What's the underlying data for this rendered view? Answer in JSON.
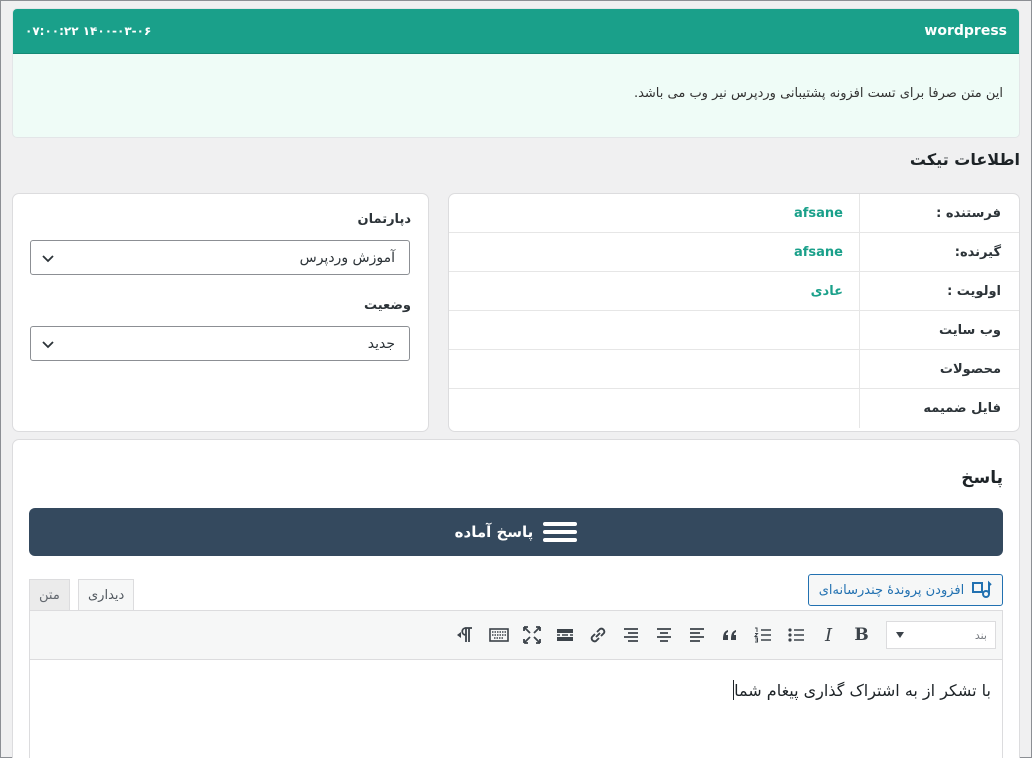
{
  "message": {
    "author": "wordpress",
    "date": "۰۷:۰۰:۲۲ ۱۴۰۰-۰۳-۰۶",
    "body": "این متن صرفا برای تست افزونه پشتیبانی وردپرس نیر وب می باشد."
  },
  "ticket_info": {
    "title": "اطلاعات تیکت",
    "rows": [
      {
        "label": "فرستنده :",
        "value": "afsane"
      },
      {
        "label": "گیرنده:",
        "value": "afsane"
      },
      {
        "label": "اولویت :",
        "value": "عادی"
      },
      {
        "label": "وب سایت",
        "value": ""
      },
      {
        "label": "محصولات",
        "value": ""
      },
      {
        "label": "فایل ضمیمه",
        "value": ""
      }
    ]
  },
  "department": {
    "label": "دپارتمان",
    "selected": "آموزش وردپرس"
  },
  "status": {
    "label": "وضعیت",
    "selected": "جدید"
  },
  "reply": {
    "title": "پاسخ",
    "ready_button": "پاسخ آماده",
    "add_media": "افزودن پروندهٔ چندرسانه‌ای",
    "tabs": [
      "دیداری",
      "متن"
    ],
    "format_select": "بند",
    "content": "با تشکر از به اشتراک گذاری پیغام شما",
    "toolbar_icons": [
      "bold-icon",
      "italic-icon",
      "bullet-list-icon",
      "numbered-list-icon",
      "blockquote-icon",
      "align-left-icon",
      "align-center-icon",
      "align-right-icon",
      "link-icon",
      "read-more-icon",
      "fullscreen-icon",
      "keyboard-toolbar-icon",
      "paragraph-direction-icon"
    ]
  },
  "colors": {
    "header_green": "#1aa08a",
    "ready_button_bg": "#34495e",
    "link_blue": "#2271b1"
  }
}
